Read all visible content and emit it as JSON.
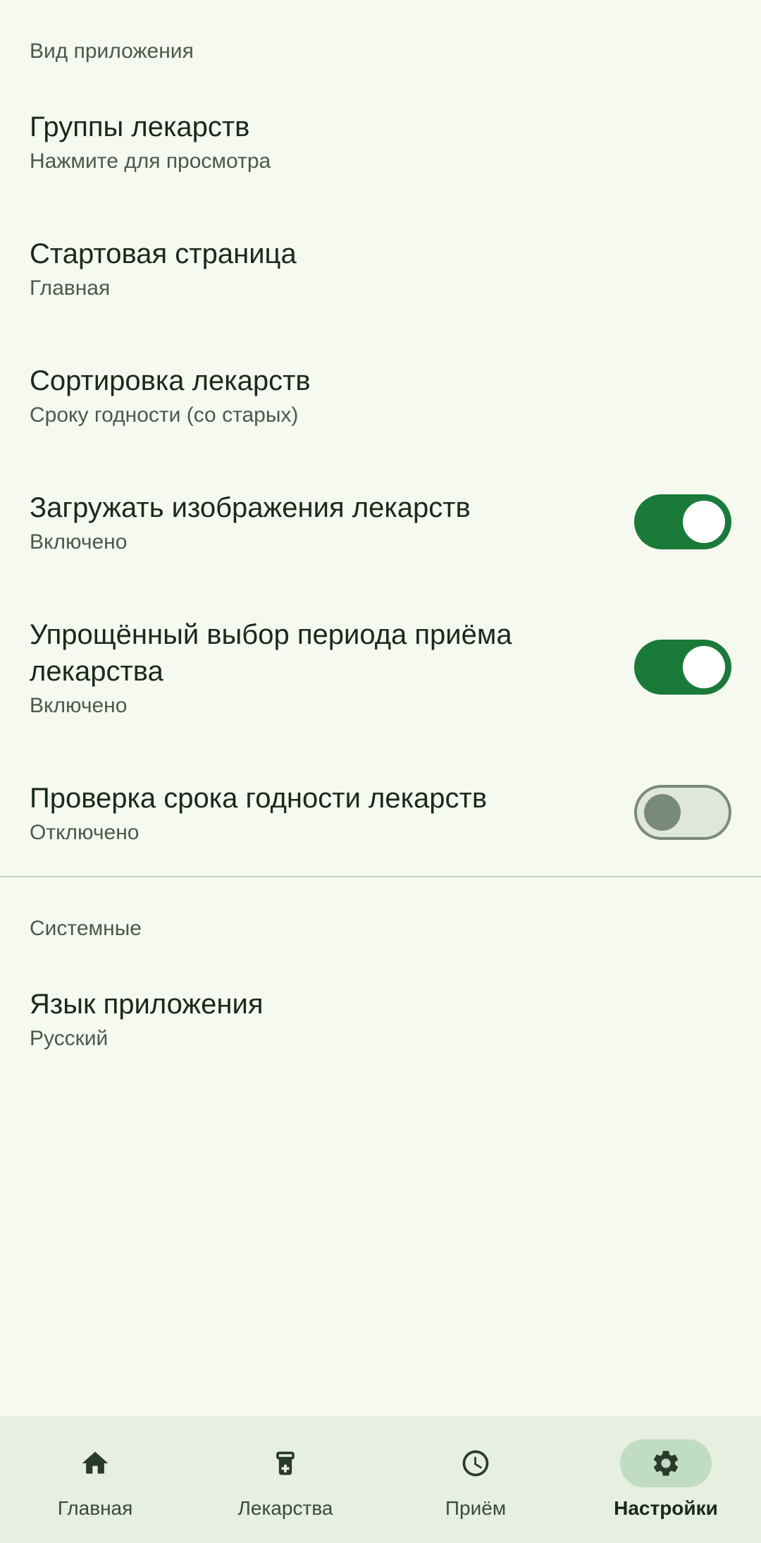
{
  "sections": {
    "appearance": {
      "header": "Вид приложения",
      "items": [
        {
          "title": "Группы лекарств",
          "subtitle": "Нажмите для просмотра"
        },
        {
          "title": "Стартовая страница",
          "subtitle": "Главная"
        },
        {
          "title": "Сортировка лекарств",
          "subtitle": "Сроку годности (со старых)"
        },
        {
          "title": "Загружать изображения лекарств",
          "subtitle": "Включено"
        },
        {
          "title": "Упрощённый выбор периода приёма лекарства",
          "subtitle": "Включено"
        },
        {
          "title": "Проверка срока годности лекарств",
          "subtitle": "Отключено"
        }
      ]
    },
    "system": {
      "header": "Системные",
      "items": [
        {
          "title": "Язык приложения",
          "subtitle": "Русский"
        }
      ]
    }
  },
  "nav": {
    "items": [
      {
        "label": "Главная"
      },
      {
        "label": "Лекарства"
      },
      {
        "label": "Приём"
      },
      {
        "label": "Настройки"
      }
    ]
  }
}
